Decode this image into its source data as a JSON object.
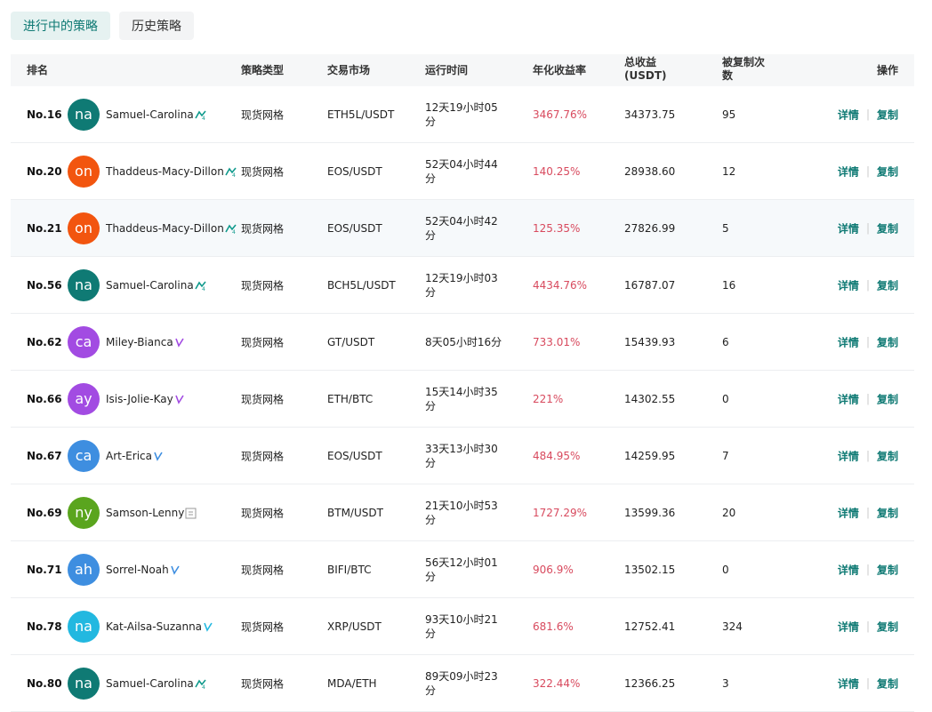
{
  "tabs": {
    "active": "进行中的策略",
    "history": "历史策略"
  },
  "columns": {
    "rank": "排名",
    "type": "策略类型",
    "market": "交易市场",
    "runtime": "运行时间",
    "apy": "年化收益率",
    "profit_line1": "总收益",
    "profit_line2": "(USDT)",
    "copies_line1": "被复制次",
    "copies_line2": "数",
    "actions": "操作"
  },
  "actions": {
    "detail": "详情",
    "copy": "复制",
    "separator": "|"
  },
  "colors": {
    "accent": "#0f7a74",
    "apy": "#d84a5e"
  },
  "rows": [
    {
      "rank": "No.16",
      "initials": "na",
      "avatar_color": "#0f7a74",
      "name": "Samuel-Carolina",
      "badge_icon": "rocket-badge-icon",
      "type": "现货网格",
      "market": "ETH5L/USDT",
      "time1": "12天19小时05",
      "time2": "分",
      "apy": "3467.76%",
      "profit": "34373.75",
      "copies": "95"
    },
    {
      "rank": "No.20",
      "initials": "on",
      "avatar_color": "#f2550f",
      "name": "Thaddeus-Macy-Dillon",
      "badge_icon": "rocket-badge-icon",
      "type": "现货网格",
      "market": "EOS/USDT",
      "time1": "52天04小时44",
      "time2": "分",
      "apy": "140.25%",
      "profit": "28938.60",
      "copies": "12"
    },
    {
      "rank": "No.21",
      "initials": "on",
      "avatar_color": "#f2550f",
      "name": "Thaddeus-Macy-Dillon",
      "badge_icon": "rocket-badge-icon",
      "type": "现货网格",
      "market": "EOS/USDT",
      "time1": "52天04小时42",
      "time2": "分",
      "apy": "125.35%",
      "profit": "27826.99",
      "copies": "5"
    },
    {
      "rank": "No.56",
      "initials": "na",
      "avatar_color": "#0f7a74",
      "name": "Samuel-Carolina",
      "badge_icon": "rocket-badge-icon",
      "type": "现货网格",
      "market": "BCH5L/USDT",
      "time1": "12天19小时03",
      "time2": "分",
      "apy": "4434.76%",
      "profit": "16787.07",
      "copies": "16"
    },
    {
      "rank": "No.62",
      "initials": "ca",
      "avatar_color": "#a24be2",
      "name": "Miley-Bianca",
      "badge_icon": "level-badge-icon",
      "type": "现货网格",
      "market": "GT/USDT",
      "time1": "8天05小时16分",
      "time2": "",
      "apy": "733.01%",
      "profit": "15439.93",
      "copies": "6"
    },
    {
      "rank": "No.66",
      "initials": "ay",
      "avatar_color": "#a24be2",
      "name": "Isis-Jolie-Kay",
      "badge_icon": "level-badge-icon",
      "type": "现货网格",
      "market": "ETH/BTC",
      "time1": "15天14小时35",
      "time2": "分",
      "apy": "221%",
      "profit": "14302.55",
      "copies": "0"
    },
    {
      "rank": "No.67",
      "initials": "ca",
      "avatar_color": "#3e8ee0",
      "name": "Art-Erica",
      "badge_icon": "level-badge-icon",
      "type": "现货网格",
      "market": "EOS/USDT",
      "time1": "33天13小时30",
      "time2": "分",
      "apy": "484.95%",
      "profit": "14259.95",
      "copies": "7"
    },
    {
      "rank": "No.69",
      "initials": "ny",
      "avatar_color": "#5aa51e",
      "name": "Samson-Lenny",
      "badge_icon": "box-badge-icon",
      "type": "现货网格",
      "market": "BTM/USDT",
      "time1": "21天10小时53",
      "time2": "分",
      "apy": "1727.29%",
      "profit": "13599.36",
      "copies": "20"
    },
    {
      "rank": "No.71",
      "initials": "ah",
      "avatar_color": "#3e8ee0",
      "name": "Sorrel-Noah",
      "badge_icon": "level-badge-icon",
      "type": "现货网格",
      "market": "BIFI/BTC",
      "time1": "56天12小时01",
      "time2": "分",
      "apy": "906.9%",
      "profit": "13502.15",
      "copies": "0"
    },
    {
      "rank": "No.78",
      "initials": "na",
      "avatar_color": "#22b8e0",
      "name": "Kat-Ailsa-Suzanna",
      "badge_icon": "level-badge-icon",
      "type": "现货网格",
      "market": "XRP/USDT",
      "time1": "93天10小时21",
      "time2": "分",
      "apy": "681.6%",
      "profit": "12752.41",
      "copies": "324"
    },
    {
      "rank": "No.80",
      "initials": "na",
      "avatar_color": "#0f7a74",
      "name": "Samuel-Carolina",
      "badge_icon": "rocket-badge-icon",
      "type": "现货网格",
      "market": "MDA/ETH",
      "time1": "89天09小时23",
      "time2": "分",
      "apy": "322.44%",
      "profit": "12366.25",
      "copies": "3"
    }
  ]
}
